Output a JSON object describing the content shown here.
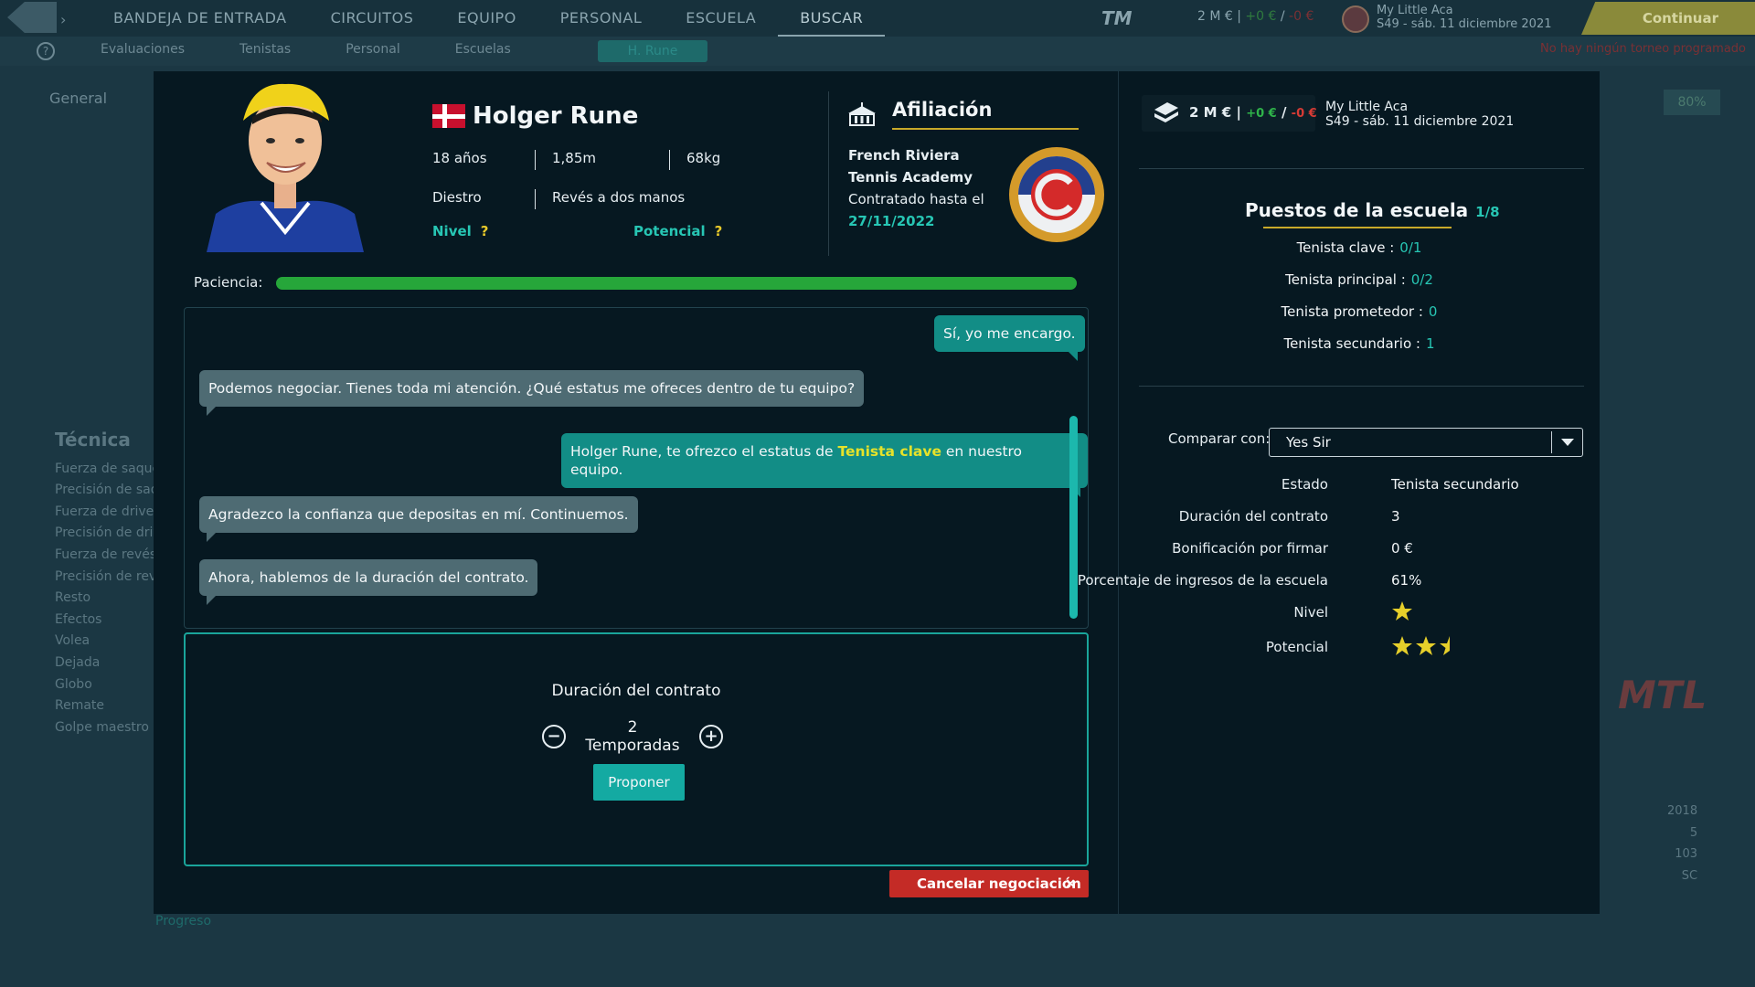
{
  "nav": {
    "items": [
      "BANDEJA DE ENTRADA",
      "CIRCUITOS",
      "EQUIPO",
      "PERSONAL",
      "ESCUELA",
      "BUSCAR"
    ],
    "active": "BUSCAR",
    "subitems": [
      "Evaluaciones",
      "Tenistas",
      "Personal",
      "Escuelas"
    ],
    "sub_active": "H. Rune",
    "continue_label": "Continuar",
    "no_tournament": "No hay ningún torneo programado",
    "tm_label": "TM"
  },
  "bg": {
    "general_tab": "General",
    "section_title": "Técnica",
    "skills": [
      "Fuerza de saque",
      "Precisión de saque",
      "Fuerza de drive",
      "Precisión de drive",
      "Fuerza de revés",
      "Precisión de revés",
      "Resto",
      "Efectos",
      "Volea",
      "Dejada",
      "Globo",
      "Remate",
      "Golpe maestro"
    ],
    "percent": "80%",
    "years": [
      "2018",
      "5",
      "103",
      "SC"
    ],
    "progress_label": "Progreso",
    "mtl_label": "MTL"
  },
  "player": {
    "name": "Holger Rune",
    "age": "18 años",
    "height": "1,85m",
    "weight": "68kg",
    "hand": "Diestro",
    "backhand": "Revés a dos manos",
    "nivel_label": "Nivel",
    "potencial_label": "Potencial",
    "unknown": "?"
  },
  "affiliation": {
    "title": "Afiliación",
    "academy": "French Riviera Tennis Academy",
    "contract_label": "Contratado hasta el",
    "contract_date": "27/11/2022"
  },
  "patience": {
    "label": "Paciencia:",
    "value": 1.0
  },
  "chat": [
    {
      "side": "out",
      "text": "Sí, yo me encargo."
    },
    {
      "side": "in",
      "text": "Podemos negociar. Tienes toda mi atención. ¿Qué estatus me ofreces dentro de tu equipo?"
    },
    {
      "side": "out",
      "pre": "Holger Rune, te ofrezco el estatus de ",
      "highlight": "Tenista clave",
      "post": " en nuestro equipo."
    },
    {
      "side": "in",
      "text": "Agradezco la confianza que depositas en mí. Continuemos."
    },
    {
      "side": "in",
      "text": "Ahora, hablemos de la duración del contrato."
    }
  ],
  "proposal": {
    "title": "Duración del contrato",
    "value": "2 Temporadas",
    "minus": "−",
    "plus": "+",
    "propose_label": "Proponer"
  },
  "cancel": {
    "label": "Cancelar negociación",
    "x": "×"
  },
  "finance": {
    "balance": "2 M €",
    "sep": "|",
    "income": "+0 €",
    "slash": "/",
    "expense": "-0 €",
    "academy_name": "My Little Aca",
    "date": "S49 - sáb. 11 diciembre 2021"
  },
  "slots": {
    "title": "Puestos de la escuela",
    "count": "1/8",
    "rows": [
      {
        "label": "Tenista clave :",
        "value": "0/1"
      },
      {
        "label": "Tenista principal :",
        "value": "0/2"
      },
      {
        "label": "Tenista prometedor :",
        "value": "0"
      },
      {
        "label": "Tenista secundario :",
        "value": "1"
      }
    ]
  },
  "compare": {
    "label": "Comparar con:",
    "selected": "Yes Sir",
    "rows": [
      {
        "label": "Estado",
        "value": "Tenista secundario"
      },
      {
        "label": "Duración del contrato",
        "value": "3"
      },
      {
        "label": "Bonificación por firmar",
        "value": "0 €"
      },
      {
        "label": "Porcentaje de ingresos de la escuela",
        "value": "61%"
      }
    ],
    "nivel_label": "Nivel",
    "nivel_stars": 1,
    "potencial_label": "Potencial",
    "potencial_stars": 2.5
  },
  "colors": {
    "accent": "#27c6b4",
    "gold": "#c8a92a",
    "patience": "#26a63a",
    "cancel": "#c42b26"
  }
}
